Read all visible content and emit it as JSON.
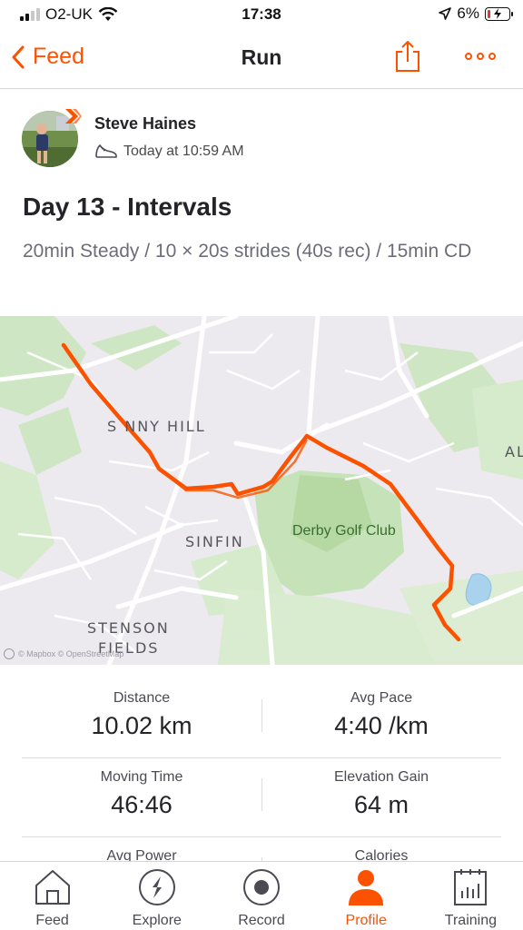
{
  "status_bar": {
    "carrier": "O2-UK",
    "time": "17:38",
    "battery": "6%"
  },
  "nav": {
    "back_label": "Feed",
    "title": "Run"
  },
  "athlete": {
    "name": "Steve Haines",
    "timestamp": "Today at 10:59 AM"
  },
  "activity": {
    "title": "Day 13 - Intervals",
    "description": "20min Steady / 10 × 20s strides (40s rec) / 15min CD"
  },
  "map": {
    "labels": {
      "sunny_hill": "S NNY HILL",
      "sinfin": "SINFIN",
      "golf": "Derby Golf Club",
      "stenson": "STENSON",
      "fields": "FIELDS",
      "al": "AL"
    },
    "attribution": "© Mapbox © OpenStreetMap",
    "route_color": "#fc5200"
  },
  "stats": [
    {
      "left": {
        "label": "Distance",
        "value": "10.02 km"
      },
      "right": {
        "label": "Avg Pace",
        "value": "4:40 /km"
      }
    },
    {
      "left": {
        "label": "Moving Time",
        "value": "46:46"
      },
      "right": {
        "label": "Elevation Gain",
        "value": "64 m"
      }
    },
    {
      "left": {
        "label": "Avg Power",
        "value": ""
      },
      "right": {
        "label": "Calories",
        "value": ""
      }
    }
  ],
  "tabs": [
    {
      "label": "Feed",
      "icon": "home-icon"
    },
    {
      "label": "Explore",
      "icon": "compass-icon"
    },
    {
      "label": "Record",
      "icon": "record-icon"
    },
    {
      "label": "Profile",
      "icon": "person-icon",
      "active": true
    },
    {
      "label": "Training",
      "icon": "calendar-chart-icon"
    }
  ],
  "colors": {
    "accent": "#fc5200",
    "text": "#242428",
    "muted": "#6d6d78"
  }
}
